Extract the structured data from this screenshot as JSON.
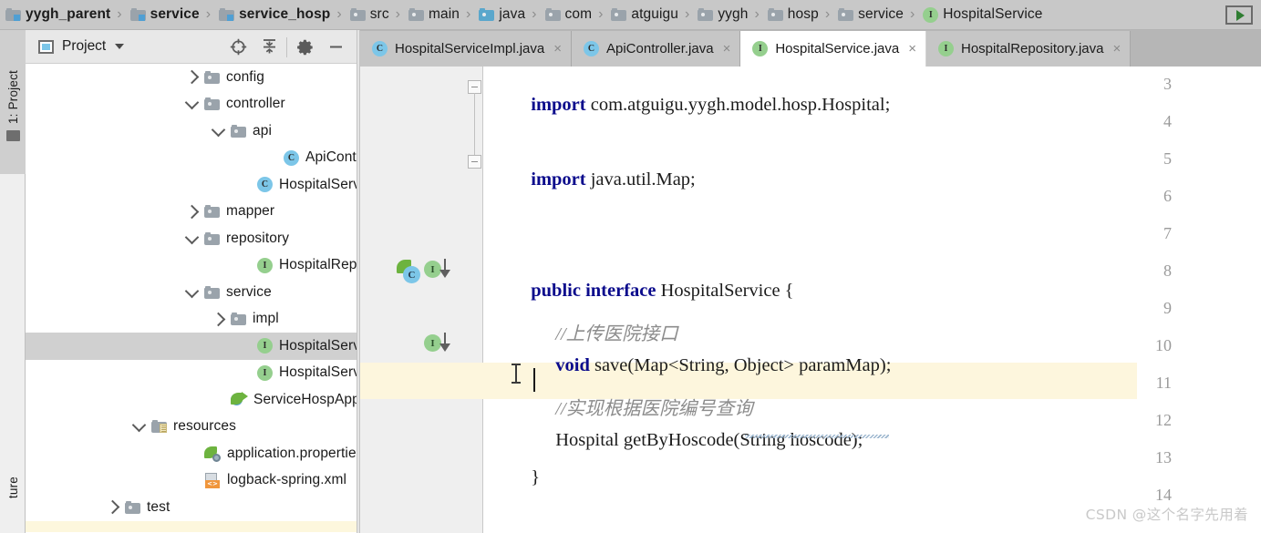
{
  "breadcrumb": {
    "items": [
      {
        "label": "yygh_parent",
        "icon": "module-folder-icon",
        "bold": true
      },
      {
        "label": "service",
        "icon": "module-folder-icon",
        "bold": true
      },
      {
        "label": "service_hosp",
        "icon": "module-folder-icon",
        "bold": true
      },
      {
        "label": "src",
        "icon": "folder-icon",
        "bold": false
      },
      {
        "label": "main",
        "icon": "folder-icon",
        "bold": false
      },
      {
        "label": "java",
        "icon": "source-folder-icon",
        "bold": false
      },
      {
        "label": "com",
        "icon": "folder-icon",
        "bold": false
      },
      {
        "label": "atguigu",
        "icon": "folder-icon",
        "bold": false
      },
      {
        "label": "yygh",
        "icon": "folder-icon",
        "bold": false
      },
      {
        "label": "hosp",
        "icon": "folder-icon",
        "bold": false
      },
      {
        "label": "service",
        "icon": "folder-icon",
        "bold": false
      },
      {
        "label": "HospitalService",
        "icon": "interface-icon",
        "bold": false
      }
    ],
    "separator": "›",
    "run_button_label": "run-configuration"
  },
  "toolstrip": {
    "top_label": "1: Project",
    "bottom_label": "ture"
  },
  "project_panel": {
    "title": "Project",
    "tools": [
      "locate-icon",
      "collapse-all-icon",
      "settings-gear-icon",
      "minimize-icon"
    ],
    "tree": [
      {
        "label": "config",
        "icon": "folder-icon",
        "indent": 6,
        "twist": "right",
        "selected": false
      },
      {
        "label": "controller",
        "icon": "folder-icon",
        "indent": 6,
        "twist": "down",
        "selected": false
      },
      {
        "label": "api",
        "icon": "folder-icon",
        "indent": 7,
        "twist": "down",
        "selected": false
      },
      {
        "label": "ApiController",
        "icon": "class-icon",
        "indent": 9,
        "twist": "none",
        "selected": false
      },
      {
        "label": "HospitalServiceImpl",
        "icon": "class-icon",
        "indent": 8,
        "twist": "none",
        "selected": false
      },
      {
        "label": "mapper",
        "icon": "folder-icon",
        "indent": 6,
        "twist": "right",
        "selected": false
      },
      {
        "label": "repository",
        "icon": "folder-icon",
        "indent": 6,
        "twist": "down",
        "selected": false
      },
      {
        "label": "HospitalRepository",
        "icon": "interface-icon",
        "indent": 8,
        "twist": "none",
        "selected": false
      },
      {
        "label": "service",
        "icon": "folder-icon",
        "indent": 6,
        "twist": "down",
        "selected": false
      },
      {
        "label": "impl",
        "icon": "folder-icon",
        "indent": 7,
        "twist": "right",
        "selected": false
      },
      {
        "label": "HospitalService",
        "icon": "interface-icon",
        "indent": 8,
        "twist": "none",
        "selected": true
      },
      {
        "label": "HospitalService",
        "icon": "interface-icon",
        "indent": 8,
        "twist": "none",
        "selected": false
      },
      {
        "label": "ServiceHospApplication",
        "icon": "spring-boot-run-icon",
        "indent": 7,
        "twist": "none",
        "selected": false
      },
      {
        "label": "resources",
        "icon": "resources-folder-icon",
        "indent": 4,
        "twist": "down",
        "selected": false
      },
      {
        "label": "application.properties",
        "icon": "spring-properties-icon",
        "indent": 6,
        "twist": "none",
        "selected": false
      },
      {
        "label": "logback-spring.xml",
        "icon": "xml-file-icon",
        "indent": 6,
        "twist": "none",
        "selected": false
      },
      {
        "label": "test",
        "icon": "folder-icon",
        "indent": 3,
        "twist": "right",
        "selected": false
      }
    ]
  },
  "editor": {
    "tabs": [
      {
        "label": "HospitalServiceImpl.java",
        "icon": "class-icon",
        "active": false,
        "close": "×"
      },
      {
        "label": "ApiController.java",
        "icon": "class-icon",
        "active": false,
        "close": "×"
      },
      {
        "label": "HospitalService.java",
        "icon": "interface-icon",
        "active": true,
        "close": "×"
      },
      {
        "label": "HospitalRepository.java",
        "icon": "interface-icon",
        "active": false,
        "close": "×"
      }
    ],
    "first_visible_line": 3,
    "caret_line": 11,
    "lines": [
      {
        "n": 3,
        "text": "import com.atguigu.yygh.model.hosp.Hospital;"
      },
      {
        "n": 4,
        "text": ""
      },
      {
        "n": 5,
        "text": "import java.util.Map;"
      },
      {
        "n": 6,
        "text": ""
      },
      {
        "n": 7,
        "text": "public interface HospitalService {"
      },
      {
        "n": 8,
        "text": "    //上传医院接口"
      },
      {
        "n": 9,
        "text": "    void save(Map<String, Object> paramMap);"
      },
      {
        "n": 10,
        "text": ""
      },
      {
        "n": 11,
        "text": "    //实现根据医院编号查询"
      },
      {
        "n": 12,
        "text": "    Hospital getByHoscode(String hoscode);"
      },
      {
        "n": 13,
        "text": "}"
      },
      {
        "n": 14,
        "text": ""
      }
    ],
    "line_parts": {
      "l3": {
        "kw": "import",
        "rest": " com.atguigu.yygh.model.hosp.Hospital;"
      },
      "l5": {
        "kw": "import",
        "rest": " java.util.Map;"
      },
      "l7": {
        "kw1": "public",
        "kw2": "interface",
        "rest": " HospitalService {"
      },
      "l8": {
        "comment": "//上传医院接口"
      },
      "l9": {
        "kw": "void",
        "rest": " save(Map<String, Object> paramMap);"
      },
      "l11": {
        "comment": "//实现根据医院编号查询"
      },
      "l12": {
        "rest": "Hospital getByHoscode(String hoscode);"
      },
      "l13": {
        "rest": "}"
      }
    },
    "gutter_markers": [
      {
        "line": 7,
        "icons": [
          "spring-bean-icon",
          "class-icon",
          "implemented-by-arrow"
        ]
      },
      {
        "line": 9,
        "icons": [
          "interface-icon",
          "implemented-by-arrow"
        ]
      }
    ]
  },
  "watermark": {
    "text": "CSDN @这个名字先用着"
  },
  "colors": {
    "breadcrumb_bg": "#c8c8c8",
    "tab_bar_bg": "#b6b6b6",
    "active_tab_bg": "#ffffff",
    "gutter_bg": "#efefef",
    "selection_bg": "#d0d0d0",
    "caret_line_bg": "#fdf6dd",
    "keyword": "#0b0b8c",
    "comment": "#8c8c8c",
    "interface_badge": "#95cf8e",
    "class_badge": "#7cc6e8"
  }
}
